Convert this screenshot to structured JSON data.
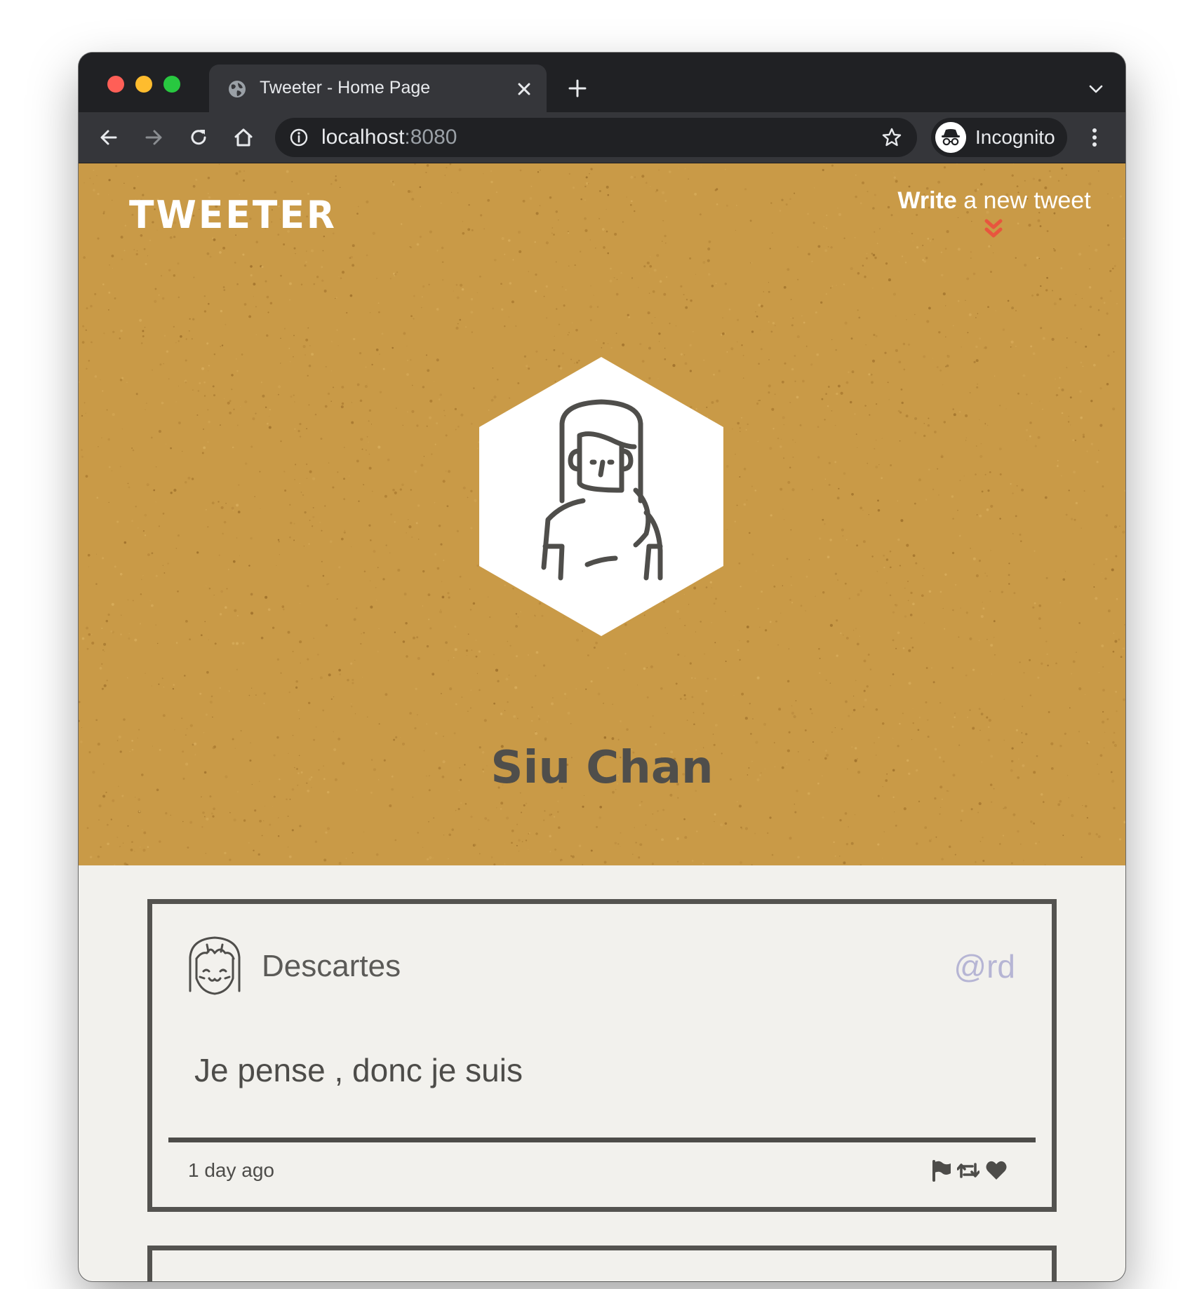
{
  "browser": {
    "tab": {
      "title": "Tweeter - Home Page",
      "favicon": "globe-icon",
      "close_icon": "close-icon"
    },
    "new_tab_icon": "plus-icon",
    "tab_list_icon": "chevron-down-icon",
    "toolbar": {
      "back_icon": "arrow-left-icon",
      "forward_icon": "arrow-right-icon",
      "reload_icon": "reload-icon",
      "home_icon": "home-icon",
      "site_info_icon": "info-icon",
      "url_host": "localhost",
      "url_port": ":8080",
      "bookmark_icon": "star-icon",
      "profile_label": "Incognito",
      "profile_icon": "incognito-icon",
      "menu_icon": "kebab-menu-icon"
    }
  },
  "page": {
    "brand": "TWEETER",
    "compose": {
      "strong": "Write",
      "rest": " a new tweet",
      "icon": "double-chevron-down-icon",
      "icon_color": "#e8553e"
    },
    "profile": {
      "name": "Siu Chan",
      "avatar_icon": "woman-avatar-icon"
    },
    "colors": {
      "header_bg": "#c99a47",
      "page_bg": "#f2f1ed",
      "border": "#545350",
      "handle": "#b6b5d4"
    },
    "tweets": [
      {
        "name": "Descartes",
        "handle": "@rd",
        "content": "Je pense , donc je suis",
        "time": "1 day ago",
        "avatar_icon": "smiling-girl-avatar-icon",
        "actions": [
          "flag-icon",
          "retweet-icon",
          "heart-icon"
        ]
      }
    ]
  }
}
